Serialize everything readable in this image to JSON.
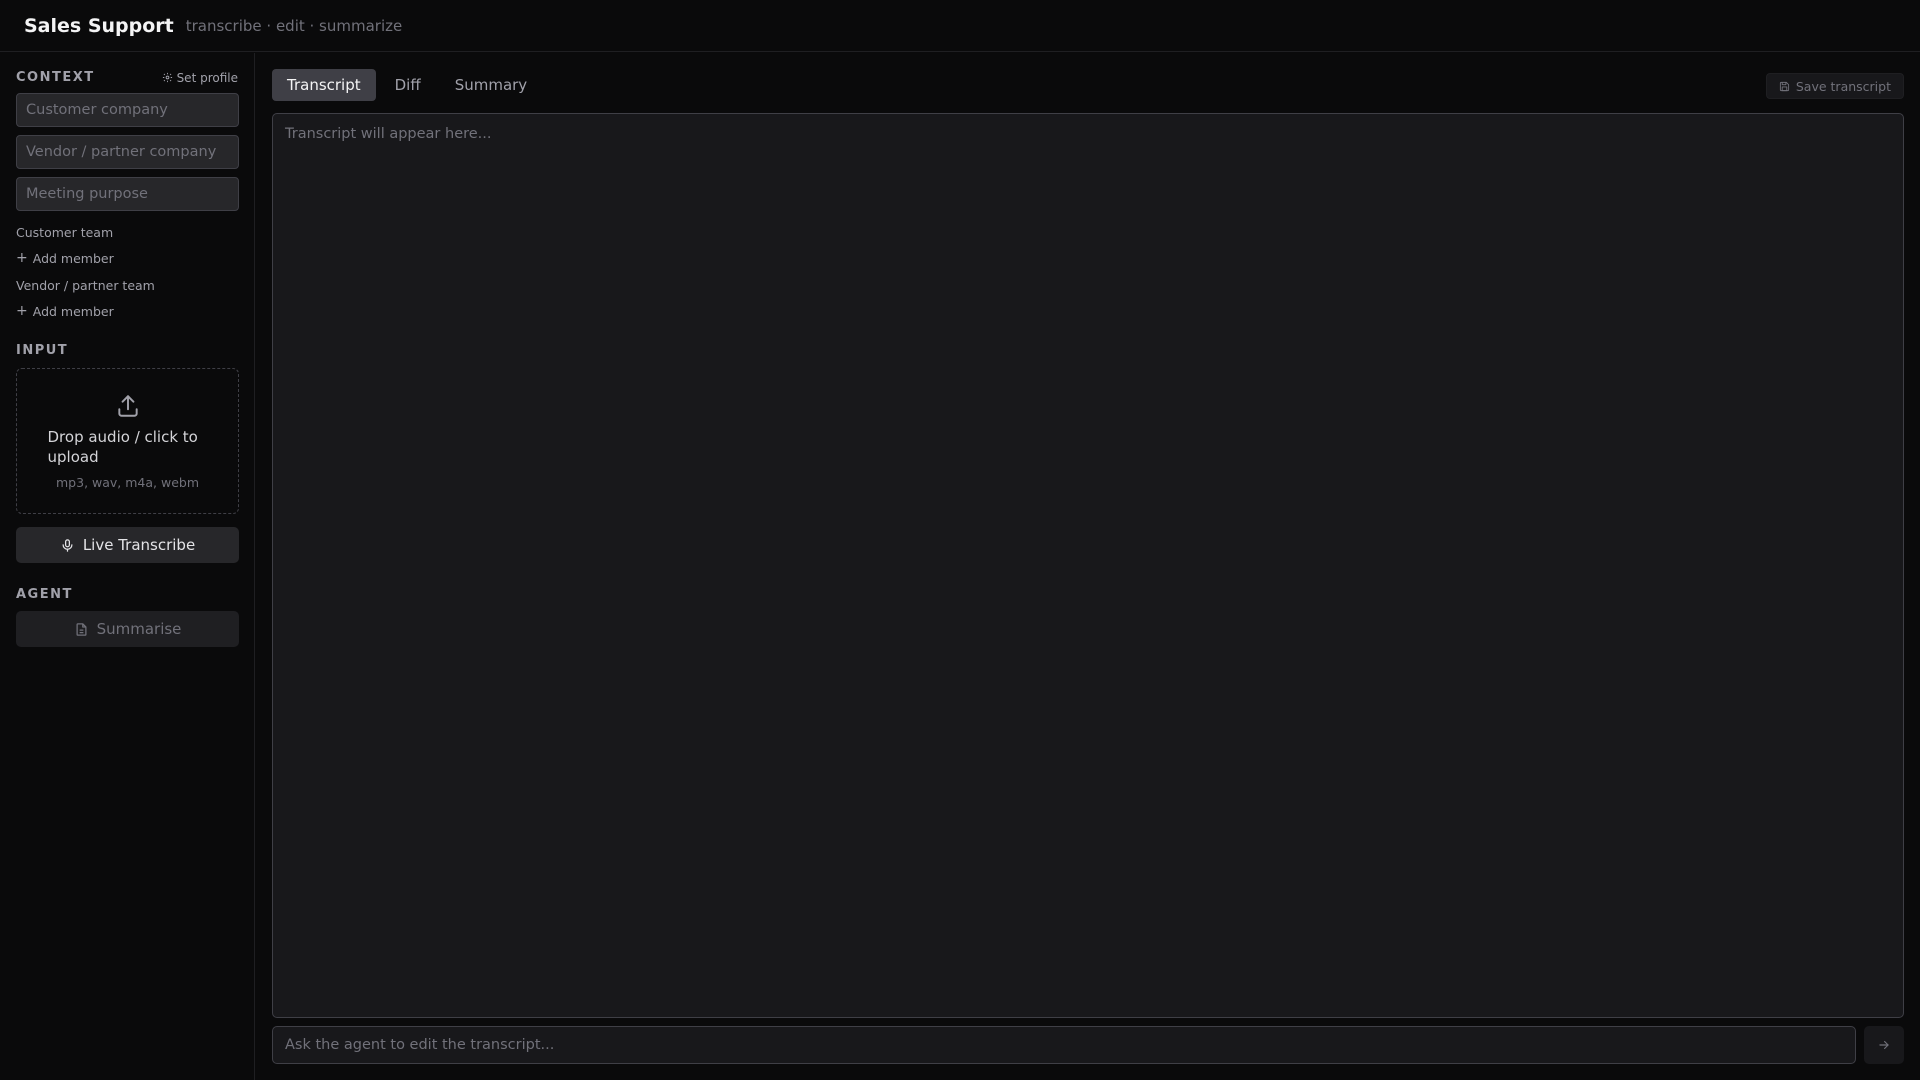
{
  "header": {
    "title": "Sales Support",
    "tagline": "transcribe · edit · summarize"
  },
  "sidebar": {
    "context": {
      "label": "CONTEXT",
      "set_profile": "Set profile",
      "customer_company_placeholder": "Customer company",
      "vendor_company_placeholder": "Vendor / partner company",
      "meeting_purpose_placeholder": "Meeting purpose",
      "customer_team_label": "Customer team",
      "vendor_team_label": "Vendor / partner team",
      "add_member": "Add member"
    },
    "input": {
      "label": "INPUT",
      "drop_title": "Drop audio / click to upload",
      "formats": "mp3, wav, m4a, webm",
      "live_button": "Live Transcribe"
    },
    "agent": {
      "label": "AGENT",
      "summarise_button": "Summarise"
    }
  },
  "main": {
    "tabs": [
      {
        "label": "Transcript",
        "active": true
      },
      {
        "label": "Diff",
        "active": false
      },
      {
        "label": "Summary",
        "active": false
      }
    ],
    "save_button": "Save transcript",
    "transcript_placeholder": "Transcript will appear here...",
    "agent_input_placeholder": "Ask the agent to edit the transcript..."
  },
  "icons": {
    "settings": "gear-icon",
    "upload": "upload-icon",
    "mic": "microphone-icon",
    "document": "document-icon",
    "save": "save-icon",
    "send": "arrow-right-icon"
  }
}
